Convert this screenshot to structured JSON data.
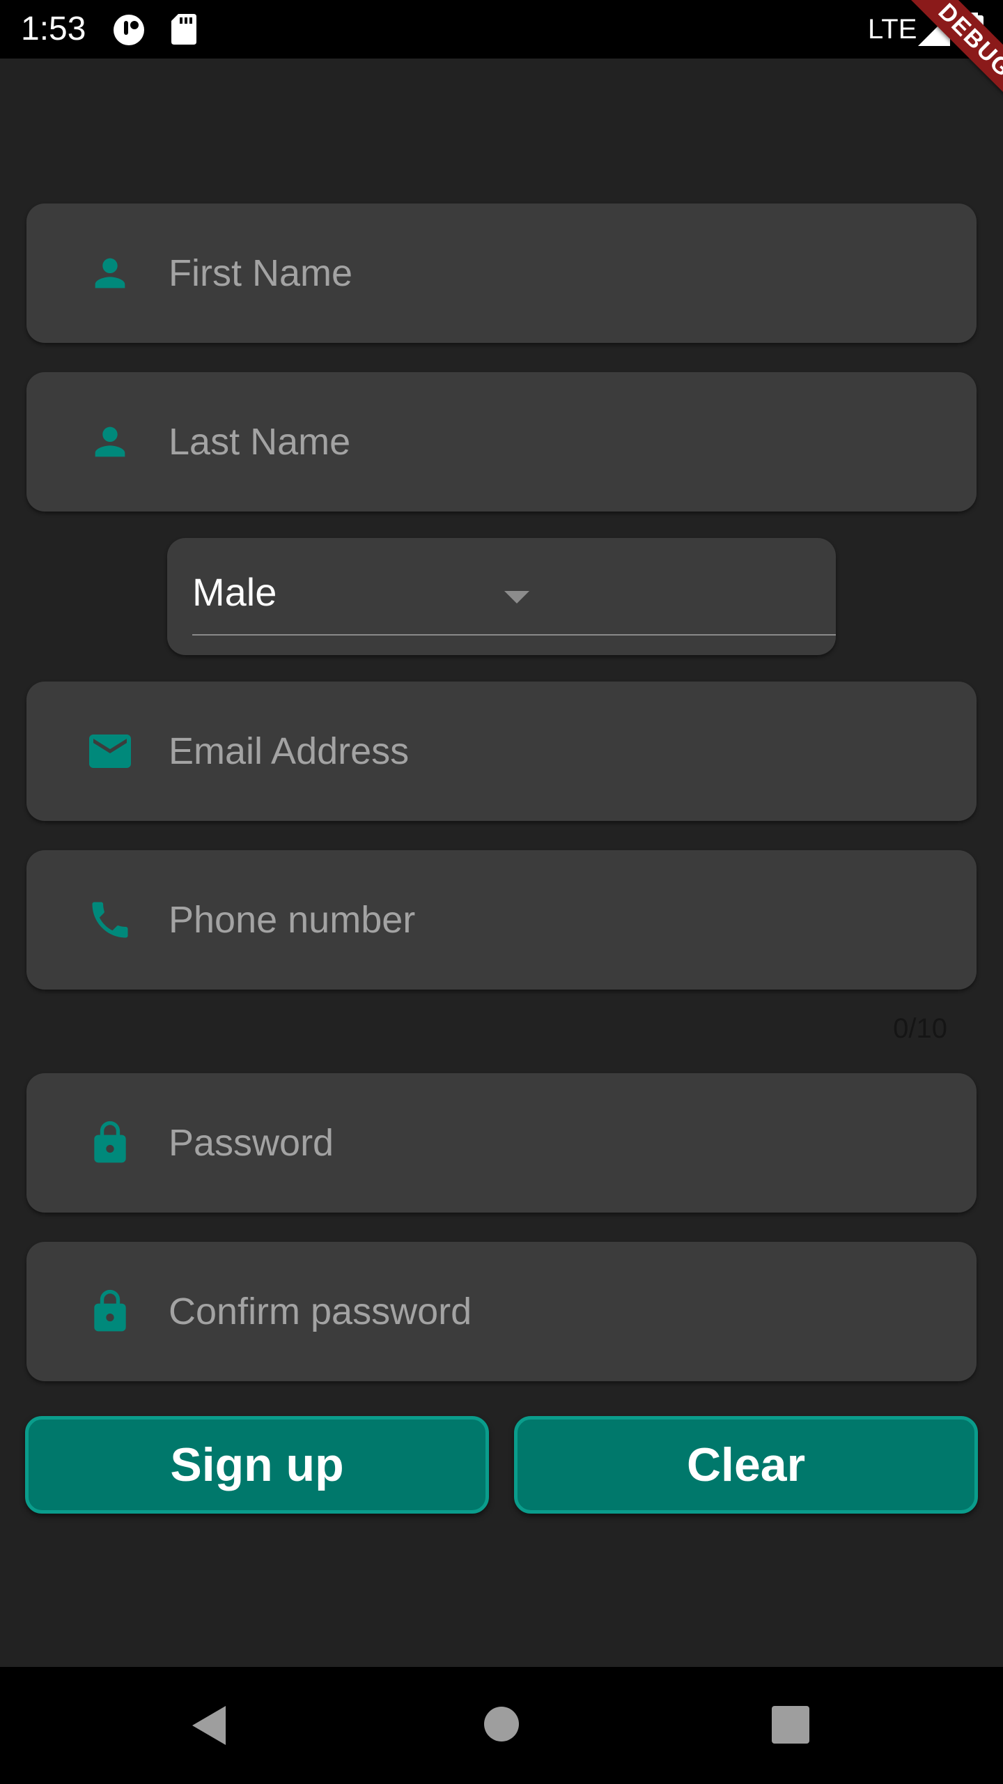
{
  "status_bar": {
    "time": "1:53",
    "network": "LTE",
    "icons": [
      "circle-app-icon",
      "sd-card-icon",
      "signal-icon",
      "battery-icon"
    ]
  },
  "debug_banner": "DEBUG",
  "form": {
    "first_name": {
      "placeholder": "First Name",
      "icon": "person-icon"
    },
    "last_name": {
      "placeholder": "Last Name",
      "icon": "person-icon"
    },
    "gender": {
      "value": "Male"
    },
    "email": {
      "placeholder": "Email Address",
      "icon": "mail-icon"
    },
    "phone": {
      "placeholder": "Phone number",
      "icon": "phone-icon",
      "counter": "0/10"
    },
    "password": {
      "placeholder": "Password",
      "icon": "lock-icon"
    },
    "confirm_password": {
      "placeholder": "Confirm password",
      "icon": "lock-icon"
    }
  },
  "buttons": {
    "sign_up": "Sign up",
    "clear": "Clear"
  },
  "nav_bar": [
    "back-icon",
    "home-icon",
    "recents-icon"
  ],
  "colors": {
    "background": "#222222",
    "field_background": "#3c3c3c",
    "accent": "#00897b",
    "button": "#00786b",
    "placeholder": "#a3a3a3",
    "debug_ribbon": "#8b1a1a"
  }
}
